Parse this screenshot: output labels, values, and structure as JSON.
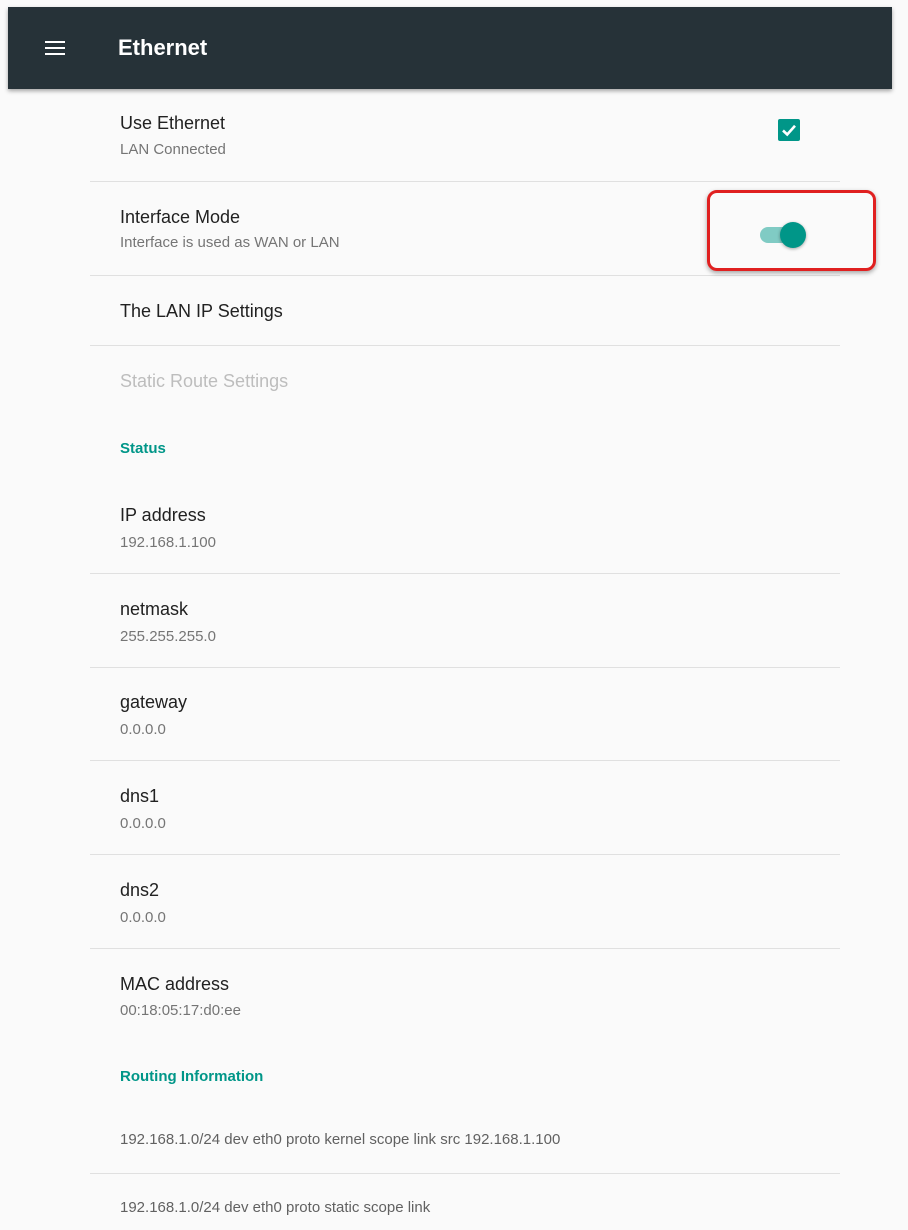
{
  "appbar": {
    "title": "Ethernet",
    "menu_icon": "hamburger-icon"
  },
  "settings": {
    "use_ethernet": {
      "title": "Use Ethernet",
      "summary": "LAN Connected",
      "checked": true
    },
    "interface_mode": {
      "title": "Interface Mode",
      "summary": "Interface is used as WAN or LAN",
      "on": true
    },
    "lan_ip": {
      "title": "The LAN IP Settings"
    },
    "static_route": {
      "title": "Static Route Settings",
      "enabled": false
    }
  },
  "status": {
    "header": "Status",
    "items": [
      {
        "title": "IP address",
        "value": "192.168.1.100"
      },
      {
        "title": "netmask",
        "value": "255.255.255.0"
      },
      {
        "title": "gateway",
        "value": "0.0.0.0"
      },
      {
        "title": "dns1",
        "value": "0.0.0.0"
      },
      {
        "title": "dns2",
        "value": "0.0.0.0"
      },
      {
        "title": "MAC address",
        "value": "00:18:05:17:d0:ee"
      }
    ]
  },
  "routing": {
    "header": "Routing Information",
    "routes": [
      "192.168.1.0/24 dev eth0  proto kernel  scope link  src 192.168.1.100",
      "192.168.1.0/24 dev eth0  proto static  scope link"
    ]
  },
  "colors": {
    "appbar": "#263238",
    "accent": "#009688",
    "highlight": "#e02020",
    "background": "#fafafa"
  }
}
